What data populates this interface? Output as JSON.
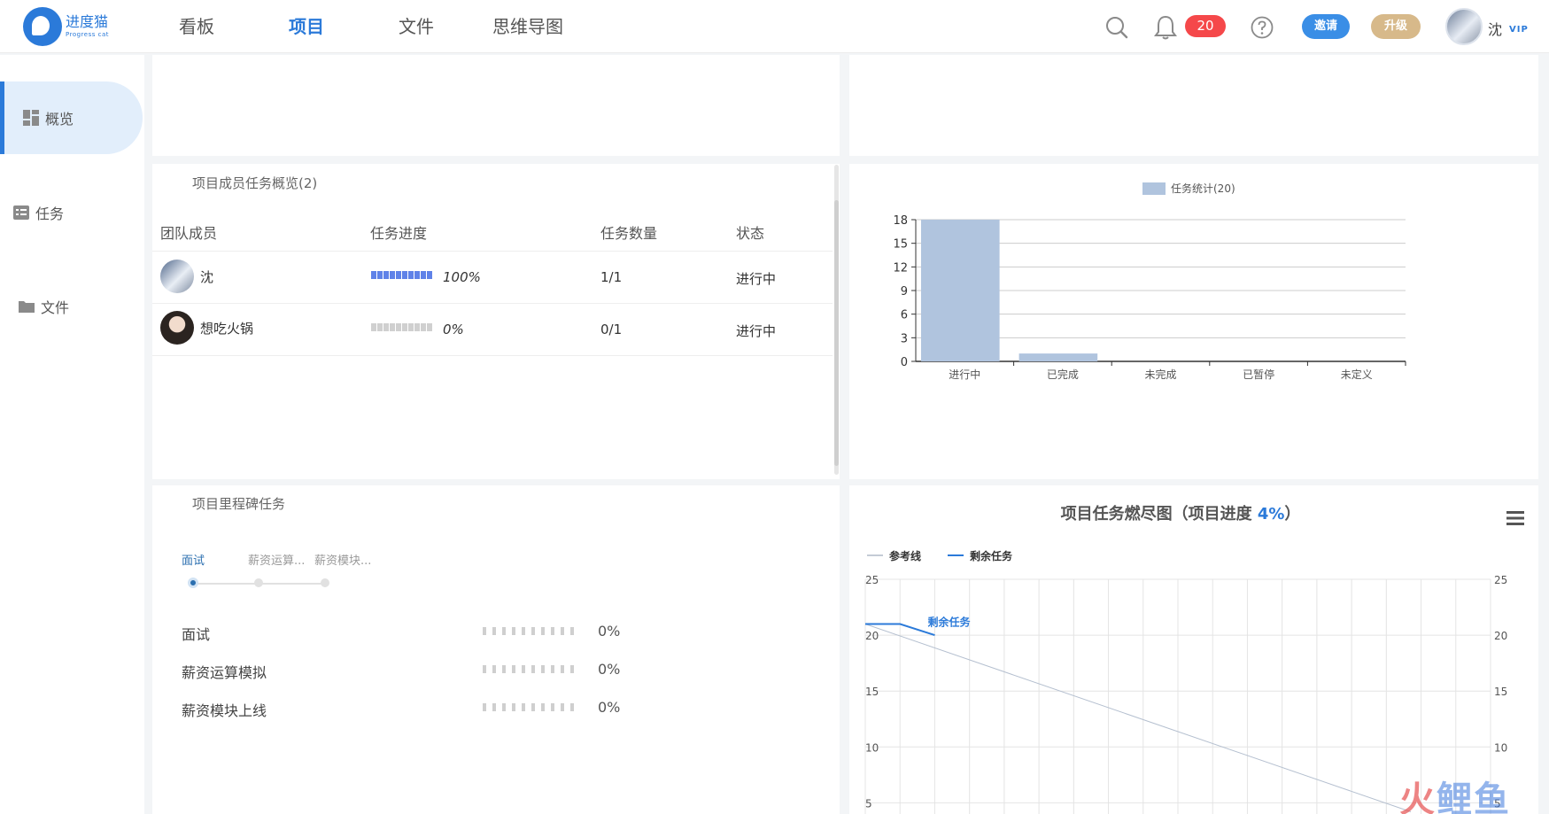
{
  "app": {
    "logo_cn": "进度猫",
    "logo_en": "Progress cat"
  },
  "nav": {
    "items": [
      "看板",
      "项目",
      "文件",
      "思维导图"
    ],
    "active": "项目"
  },
  "header": {
    "notification_count": "20",
    "invite_label": "邀请",
    "upgrade_label": "升级",
    "user_name": "沈",
    "vip_label": "VIP"
  },
  "sidebar": {
    "items": [
      {
        "label": "概览",
        "icon": "dashboard-icon"
      },
      {
        "label": "任务",
        "icon": "task-list-icon"
      },
      {
        "label": "文件",
        "icon": "folder-icon"
      }
    ]
  },
  "members": {
    "title": "项目成员任务概览(2)",
    "headers": [
      "团队成员",
      "任务进度",
      "任务数量",
      "状态"
    ],
    "rows": [
      {
        "name": "沈",
        "progress": 1.0,
        "progress_label": "100%",
        "count": "1/1",
        "status": "进行中"
      },
      {
        "name": "想吃火锅",
        "progress": 0.0,
        "progress_label": "0%",
        "count": "0/1",
        "status": "进行中"
      }
    ]
  },
  "milestones": {
    "title": "项目里程碑任务",
    "tabs": [
      "面试",
      "薪资运算...",
      "薪资模块..."
    ],
    "items": [
      {
        "name": "面试",
        "progress": 0.0,
        "pct": "0%"
      },
      {
        "name": "薪资运算模拟",
        "progress": 0.0,
        "pct": "0%"
      },
      {
        "name": "薪资模块上线",
        "progress": 0.0,
        "pct": "0%"
      }
    ]
  },
  "colors": {
    "accent": "#2b7ad9",
    "bar": "#b0c4de",
    "progress_fill": "#5f82e8",
    "progress_empty": "#d0d0d0",
    "badge": "#f5484a",
    "upgrade": "#d7b98a"
  },
  "chart_data": [
    {
      "type": "bar",
      "legend": "任务统计(20)",
      "categories": [
        "进行中",
        "已完成",
        "未完成",
        "已暂停",
        "未定义"
      ],
      "values": [
        18,
        1,
        0,
        0,
        0
      ],
      "yticks": [
        "0",
        "3",
        "6",
        "9",
        "12",
        "15",
        "18"
      ],
      "ylim": [
        0,
        18
      ]
    },
    {
      "type": "line",
      "title_prefix": "项目任务燃尽图（项目进度 ",
      "title_value": "4%",
      "title_suffix": "）",
      "legend": [
        "参考线",
        "剩余任务"
      ],
      "series_label": "剩余任务",
      "yticks": [
        "5",
        "10",
        "15",
        "20",
        "25"
      ],
      "ylim": [
        4,
        25
      ],
      "points_visible": 17,
      "series": [
        {
          "name": "参考线",
          "values_start": 21,
          "values_end": 4.2
        },
        {
          "name": "剩余任务",
          "values": [
            21,
            21,
            20
          ]
        }
      ]
    }
  ]
}
